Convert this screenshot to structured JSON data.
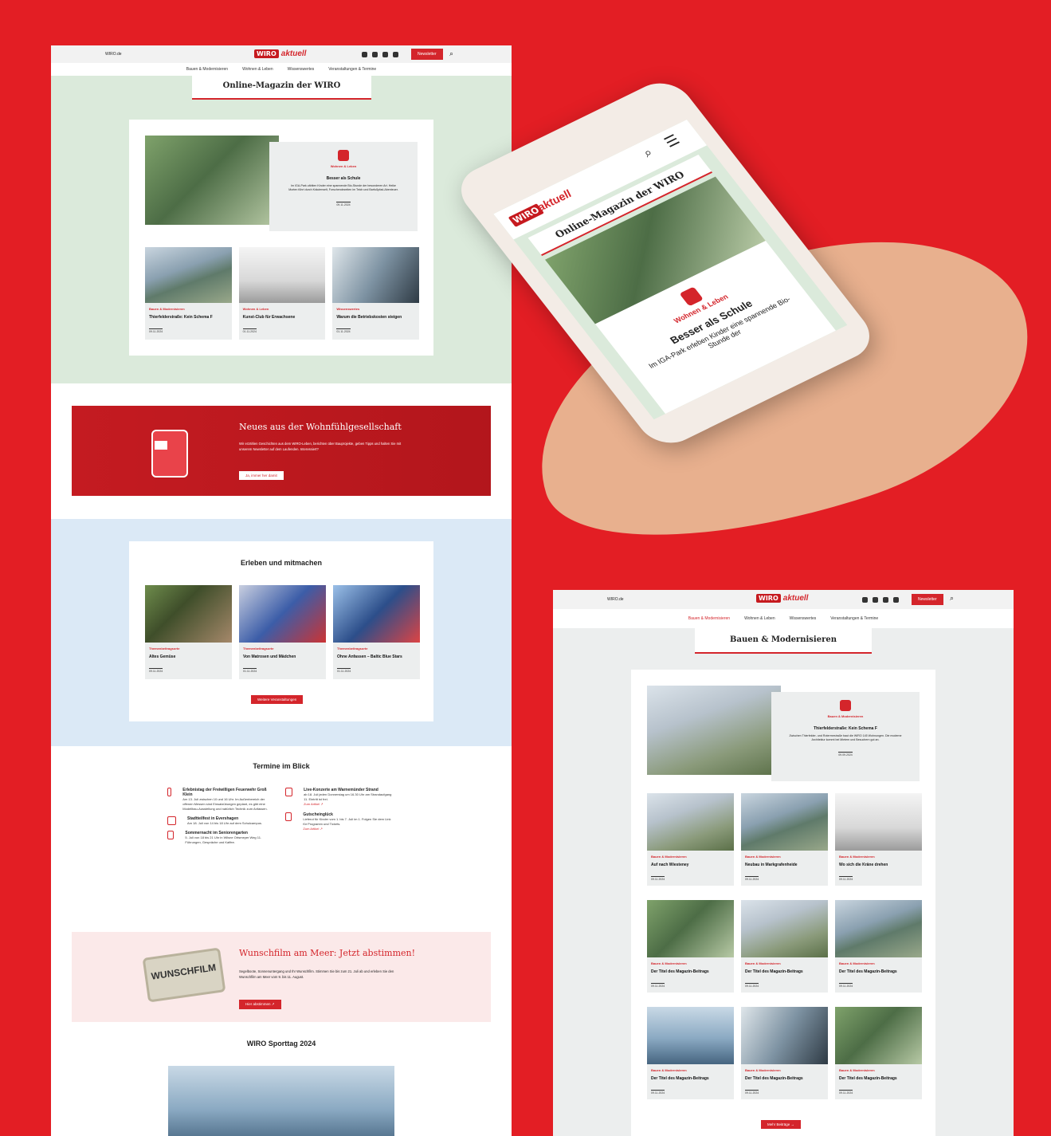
{
  "left": {
    "site_link": "WIRO.de",
    "logo_box": "WIRO",
    "logo_text": "aktuell",
    "newsletter_btn": "Newsletter",
    "nav": [
      "Bauen & Modernisieren",
      "Wohnen & Leben",
      "Wissenswertes",
      "Veranstaltungen & Termine"
    ],
    "page_title": "Online-Magazin der WIRO",
    "featured": {
      "category": "Wohnen & Leben",
      "title": "Besser als Schule",
      "text": "Im IGA-Park zählten Kinder eine spannende Bio-Stunde der besonderen Art. Heike Morten führt durch Kräuterwelt, Forschendezeiten im Teich und Barfußpfad-Abenteuer.",
      "date": "09.11.2024"
    },
    "articles": [
      {
        "category": "Bauen & Modernisieren",
        "title": "Thierfelderstraße: Kein Schema F",
        "date": "09.11.2024"
      },
      {
        "category": "Wohnen & Leben",
        "title": "Kunst-Club für Erwachsene",
        "date": "01.11.2024"
      },
      {
        "category": "Wissenswertes",
        "title": "Warum die Betriebskosten steigen",
        "date": "01.11.2024"
      }
    ],
    "promo": {
      "title": "Neues aus der Wohnfühlgesellschaft",
      "text": "Wir erzählen Geschichten aus dem WIRO-Leben, berichten über Bauprojekte, geben Tipps und halten Sie mit unserem Newsletter auf dem Laufenden. Interessiert?",
      "button": "Ja, immer her damit"
    },
    "events_section": {
      "title": "Erleben und mitmachen",
      "items": [
        {
          "category": "Themenbeitragsorte",
          "title": "Altes Gemüse",
          "date": "09.11.2024"
        },
        {
          "category": "Themenbeitragsorte",
          "title": "Von Matrosen und Mädchen",
          "date": "01.11.2024"
        },
        {
          "category": "Themenbeitragsorte",
          "title": "Ohne Anfassen – Baltic Blue Stars",
          "date": "01.11.2024"
        }
      ],
      "button": "Weitere Veranstaltungen"
    },
    "termine": {
      "title": "Termine im Blick",
      "col1": [
        {
          "title": "Erlebnistag der Freiwilligen Feuerwehr Groß Klein",
          "text": "Am 13. Juli zwischen 10 und 16 Uhr. Im Außenbereich der offenen Messen sind Einsatzübungen geplant, es gibt eine Modellbau-Ausstellung und natürlich Technik zum Anfassen."
        },
        {
          "title": "Stadtteilfest in Evershagen",
          "text": "Am 18. Juli von 14 bis 18 Uhr auf dem Schulcampus."
        },
        {
          "title": "Sommernacht im Seniorengarten",
          "text": "5. Juli von 18 bis 21 Uhr in Wilsne Ortsmeyer Weg 11. Führungen, Gespräche und Kaffee."
        }
      ],
      "col2": [
        {
          "title": "Live-Konzerte am Warnemünder Strand",
          "text": "ab 18. Juli jeden Donnerstag um 16.30 Uhr am Strandaufgang 11. Eintritt ist frei.",
          "link": "Zum Artikel ↗"
        },
        {
          "title": "Gutscheinglück",
          "text": "Lieferut für Kinder vom 1. bis 7. Juli im 1. Folgen Sie dem Link für Programm und Tickets.",
          "link": "Zum Artikel ↗"
        }
      ]
    },
    "wunschfilm": {
      "sign": "WUNSCHFILM",
      "title": "Wunschfilm am Meer: Jetzt abstimmen!",
      "text": "Segelboote, Sonnenuntergang und Ihr Wunschfilm. Stimmen Sie bis zum 21. Juli ab und erleben Sie den Wunschfilm am Meer vom 9. bis 11. August.",
      "button": "Hier abstimmen ↗"
    },
    "sporttag": {
      "title": "WIRO Sporttag 2024"
    }
  },
  "phone": {
    "logo_box": "WIRO",
    "logo_text": "aktuell",
    "title": "Online-Magazin der WIRO",
    "category": "Wohnen & Leben",
    "headline": "Besser als Schule",
    "text": "Im IGA-Park erleben Kinder eine spannende Bio-Stunde der"
  },
  "right": {
    "site_link": "WIRO.de",
    "logo_box": "WIRO",
    "logo_text": "aktuell",
    "newsletter_btn": "Newsletter",
    "nav": [
      "Bauen & Modernisieren",
      "Wohnen & Leben",
      "Wissenswertes",
      "Veranstaltungen & Termine"
    ],
    "page_title": "Bauen & Modernisieren",
    "featured": {
      "category": "Bauen & Modernisieren",
      "title": "Thierfelderstraße: Kein Schema F",
      "text": "Zwischen Thierfelder- und Roterrnestraße baut die WIRO 145 Wohnungen. Die moderne Architektur kommt bei Mietern und Besuchern gut an.",
      "date": "09.09.2024"
    },
    "grid": [
      {
        "category": "Bauen & Modernisieren",
        "title": "Auf nach Wiesteney",
        "date": "09.11.2024"
      },
      {
        "category": "Bauen & Modernisieren",
        "title": "Neubau in Markgrafenheide",
        "date": "09.11.2024"
      },
      {
        "category": "Bauen & Modernisieren",
        "title": "Wo sich die Kräne drehen",
        "date": "09.11.2024"
      },
      {
        "category": "Bauen & Modernisieren",
        "title": "Der Titel des Magazin-Beitrags",
        "date": "09.11.2024"
      },
      {
        "category": "Bauen & Modernisieren",
        "title": "Der Titel des Magazin-Beitrags",
        "date": "09.11.2024"
      },
      {
        "category": "Bauen & Modernisieren",
        "title": "Der Titel des Magazin-Beitrags",
        "date": "09.11.2024"
      },
      {
        "category": "Bauen & Modernisieren",
        "title": "Der Titel des Magazin-Beitrags",
        "date": "09.11.2024"
      },
      {
        "category": "Bauen & Modernisieren",
        "title": "Der Titel des Magazin-Beitrags",
        "date": "09.11.2024"
      },
      {
        "category": "Bauen & Modernisieren",
        "title": "Der Titel des Magazin-Beitrags",
        "date": "09.11.2024"
      }
    ],
    "more_button": "Mehr Beiträge →"
  }
}
